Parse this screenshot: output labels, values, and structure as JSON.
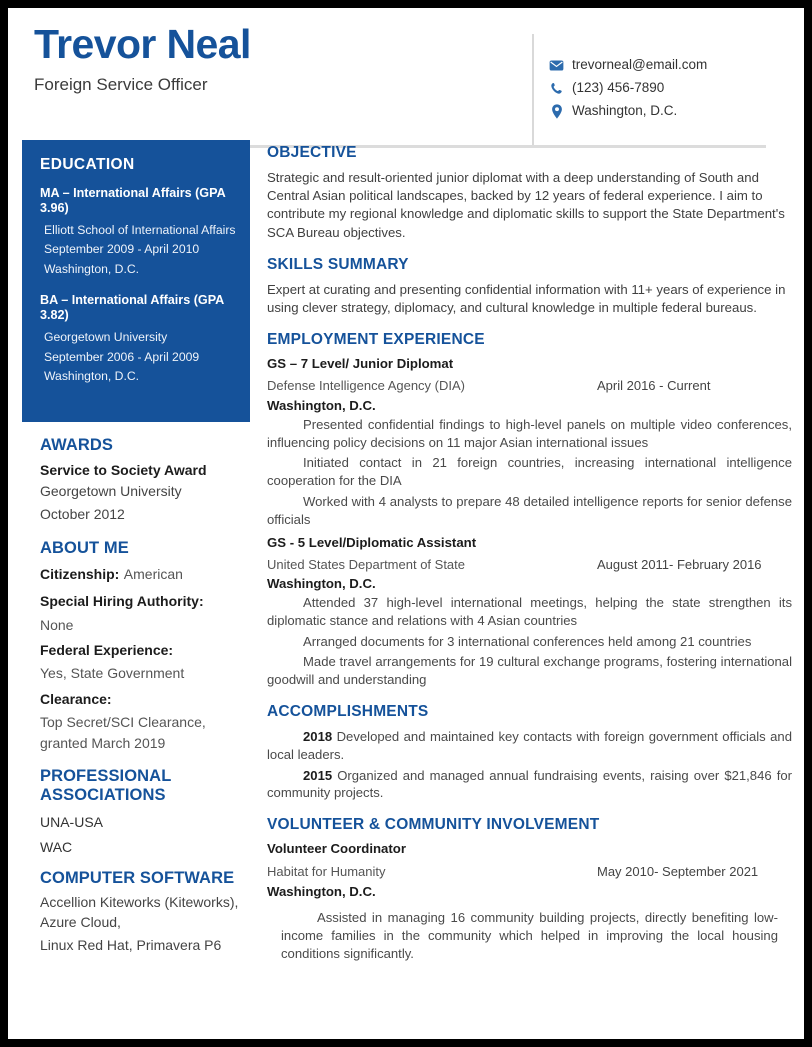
{
  "header": {
    "name": "Trevor Neal",
    "job_title": "Foreign Service Officer",
    "contact": [
      {
        "icon": "email-icon",
        "text": "trevorneal@email.com"
      },
      {
        "icon": "phone-icon",
        "text": "(123) 456-7890"
      },
      {
        "icon": "location-pin-icon",
        "text": "Washington, D.C."
      }
    ]
  },
  "colors": {
    "accent_blue": "#15529a",
    "icon_blue": "#2c6bad",
    "body_text": "#404040"
  },
  "sidebar": {
    "education": {
      "heading": "EDUCATION",
      "entries": [
        {
          "degree": "MA – International Affairs (GPA 3.96)",
          "school": "Elliott School of International Affairs",
          "dates": "September 2009 - April 2010",
          "location": "Washington, D.C."
        },
        {
          "degree": "BA – International Affairs (GPA 3.82)",
          "school": "Georgetown University",
          "dates": "September 2006 - April 2009",
          "location": "Washington, D.C."
        }
      ]
    },
    "awards": {
      "heading": "AWARDS",
      "title": "Service to Society Award",
      "org": "Georgetown University",
      "date": "October 2012"
    },
    "about_me": {
      "heading": "ABOUT ME",
      "fields": [
        {
          "key": "Citizenship:",
          "value": "American",
          "inline": true
        },
        {
          "key": "Special Hiring Authority:",
          "value": "None",
          "inline": false
        },
        {
          "key": "Federal Experience:",
          "value": "Yes, State Government",
          "inline": false
        },
        {
          "key": "Clearance:",
          "value": "Top Secret/SCI Clearance, granted March 2019",
          "inline": false
        }
      ]
    },
    "professional_associations": {
      "heading": "PROFESSIONAL ASSOCIATIONS",
      "items": [
        "UNA-USA",
        "WAC"
      ]
    },
    "computer_software": {
      "heading": "COMPUTER SOFTWARE",
      "lines": [
        "Accellion Kiteworks (Kiteworks), Azure Cloud,",
        "Linux Red Hat, Primavera P6"
      ]
    }
  },
  "main": {
    "objective": {
      "heading": "OBJECTIVE",
      "text": "Strategic and result-oriented junior diplomat with a deep understanding of South and Central Asian political landscapes, backed by 12 years of federal experience. I aim to contribute my regional knowledge and diplomatic skills to support the State Department's SCA Bureau objectives."
    },
    "skills_summary": {
      "heading": "SKILLS SUMMARY",
      "text": "Expert at curating and presenting confidential information with 11+ years of experience in using clever strategy, diplomacy, and cultural knowledge in multiple federal bureaus."
    },
    "employment": {
      "heading": "EMPLOYMENT EXPERIENCE",
      "jobs": [
        {
          "title": "GS – 7 Level/ Junior Diplomat",
          "employer": "Defense Intelligence Agency (DIA)",
          "dates": "April 2016 - Current",
          "location": "Washington, D.C.",
          "bullets": [
            "Presented confidential findings to high-level panels on multiple video conferences, influencing policy decisions on 11 major Asian international issues",
            "Initiated contact in 21 foreign countries, increasing international intelligence cooperation for the DIA",
            "Worked with 4 analysts to prepare 48 detailed intelligence reports for senior defense officials"
          ]
        },
        {
          "title": "GS - 5 Level/Diplomatic Assistant",
          "employer": "United States Department of State",
          "dates": "August 2011- February 2016",
          "location": "Washington, D.C.",
          "bullets": [
            "Attended 37 high-level international meetings, helping the state strengthen its diplomatic stance and relations with 4 Asian countries",
            "Arranged documents for 3 international conferences held among 21 countries",
            "Made travel arrangements for 19 cultural exchange programs, fostering international goodwill and understanding"
          ]
        }
      ]
    },
    "accomplishments": {
      "heading": "ACCOMPLISHMENTS",
      "items": [
        {
          "year": "2018",
          "text": "Developed and maintained key contacts with foreign government officials and local leaders."
        },
        {
          "year": "2015",
          "text": "Organized and managed annual fundraising events, raising over $21,846 for community projects."
        }
      ]
    },
    "volunteer": {
      "heading": "VOLUNTEER & COMMUNITY INVOLVEMENT",
      "role": "Volunteer Coordinator",
      "org": "Habitat for Humanity",
      "dates": "May 2010- September 2021",
      "location": "Washington, D.C.",
      "bullets": [
        "Assisted in managing 16 community building projects, directly benefiting low-income families in the community which helped in improving the local housing conditions significantly."
      ]
    }
  }
}
